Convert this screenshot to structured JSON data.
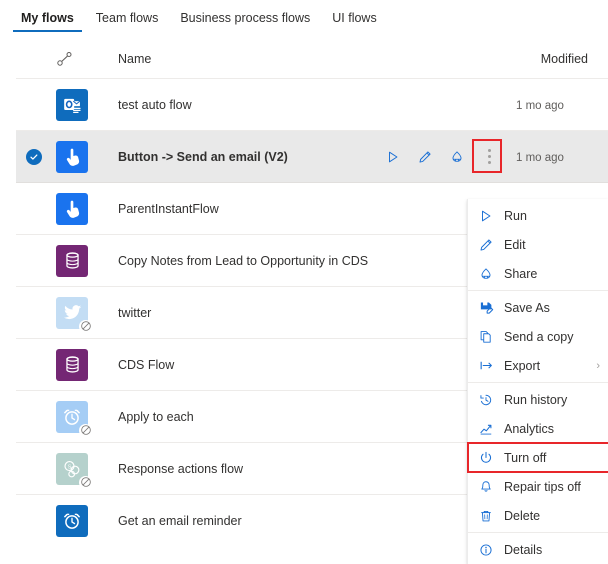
{
  "tabs": [
    {
      "label": "My flows",
      "active": true
    },
    {
      "label": "Team flows",
      "active": false
    },
    {
      "label": "Business process flows",
      "active": false
    },
    {
      "label": "UI flows",
      "active": false
    }
  ],
  "table": {
    "headers": {
      "flow_icon": "flow-type-icon",
      "name": "Name",
      "modified": "Modified"
    },
    "rows": [
      {
        "name": "test auto flow",
        "modified": "1 mo ago",
        "icon": "outlook-automated-icon",
        "icon_color": "#0f6cbd",
        "selected": false,
        "disabled": false
      },
      {
        "name": "Button -> Send an email (V2)",
        "modified": "1 mo ago",
        "icon": "instant-button-icon",
        "icon_color": "#1a73ee",
        "selected": true,
        "disabled": false
      },
      {
        "name": "ParentInstantFlow",
        "modified": "",
        "icon": "instant-button-icon",
        "icon_color": "#1a73ee",
        "selected": false,
        "disabled": false
      },
      {
        "name": "Copy Notes from Lead to Opportunity in CDS",
        "modified": "",
        "icon": "cds-database-icon",
        "icon_color": "#742774",
        "selected": false,
        "disabled": false
      },
      {
        "name": "twitter",
        "modified": "",
        "icon": "twitter-icon",
        "icon_color": "#c3ddf4",
        "selected": false,
        "disabled": true
      },
      {
        "name": "CDS Flow",
        "modified": "",
        "icon": "cds-database-icon",
        "icon_color": "#742774",
        "selected": false,
        "disabled": false
      },
      {
        "name": "Apply to each",
        "modified": "",
        "icon": "scheduled-clock-icon",
        "icon_color": "#a5cdf5",
        "selected": false,
        "disabled": true
      },
      {
        "name": "Response actions flow",
        "modified": "",
        "icon": "sharepoint-icon",
        "icon_color": "#b5d1cc",
        "selected": false,
        "disabled": true
      },
      {
        "name": "Get an email reminder",
        "modified": "",
        "icon": "scheduled-clock-icon",
        "icon_color": "#0f6cbd",
        "selected": false,
        "disabled": false
      }
    ],
    "row_actions": [
      {
        "name": "run-action",
        "icon": "play-icon"
      },
      {
        "name": "edit-action",
        "icon": "pencil-icon"
      },
      {
        "name": "share-action",
        "icon": "share-icon"
      },
      {
        "name": "more-commands-action",
        "icon": "kebab-icon"
      }
    ]
  },
  "context_menu": {
    "items": [
      {
        "label": "Run",
        "icon": "play-icon",
        "divider_after": false,
        "submenu": false,
        "highlighted": false
      },
      {
        "label": "Edit",
        "icon": "pencil-icon",
        "divider_after": false,
        "submenu": false,
        "highlighted": false
      },
      {
        "label": "Share",
        "icon": "share-icon",
        "divider_after": true,
        "submenu": false,
        "highlighted": false
      },
      {
        "label": "Save As",
        "icon": "save-as-icon",
        "divider_after": false,
        "submenu": false,
        "highlighted": false
      },
      {
        "label": "Send a copy",
        "icon": "copy-icon",
        "divider_after": false,
        "submenu": false,
        "highlighted": false
      },
      {
        "label": "Export",
        "icon": "export-icon",
        "divider_after": true,
        "submenu": true,
        "highlighted": false
      },
      {
        "label": "Run history",
        "icon": "history-icon",
        "divider_after": false,
        "submenu": false,
        "highlighted": false
      },
      {
        "label": "Analytics",
        "icon": "analytics-icon",
        "divider_after": false,
        "submenu": false,
        "highlighted": false
      },
      {
        "label": "Turn off",
        "icon": "power-icon",
        "divider_after": false,
        "submenu": false,
        "highlighted": true
      },
      {
        "label": "Repair tips off",
        "icon": "bell-icon",
        "divider_after": false,
        "submenu": false,
        "highlighted": false
      },
      {
        "label": "Delete",
        "icon": "trash-icon",
        "divider_after": true,
        "submenu": false,
        "highlighted": false
      },
      {
        "label": "Details",
        "icon": "info-icon",
        "divider_after": false,
        "submenu": false,
        "highlighted": false
      }
    ],
    "submenu_glyph": "›"
  },
  "colors": {
    "accent": "#0f6cbd",
    "highlight_red": "#e8262a",
    "selected_row_bg": "#e9e9e9",
    "border": "#edebe9"
  }
}
